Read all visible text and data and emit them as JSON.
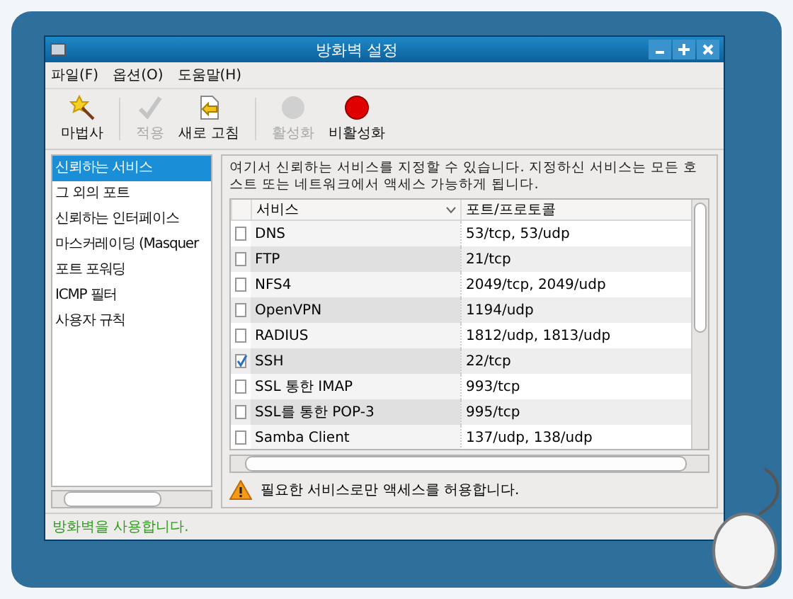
{
  "window": {
    "title": "방화벽 설정"
  },
  "menu": [
    {
      "label": "파일(F)"
    },
    {
      "label": "옵션(O)"
    },
    {
      "label": "도움말(H)"
    }
  ],
  "toolbar": [
    {
      "label": "마법사",
      "kind": "wizard",
      "disabled": false
    },
    {
      "label": "적용",
      "kind": "apply",
      "disabled": true
    },
    {
      "label": "새로 고침",
      "kind": "reload",
      "disabled": false
    },
    {
      "label": "활성화",
      "kind": "enable",
      "disabled": true
    },
    {
      "label": "비활성화",
      "kind": "disable",
      "disabled": false
    }
  ],
  "sidebar": {
    "items": [
      {
        "label": "신뢰하는 서비스",
        "selected": true
      },
      {
        "label": "그 외의 포트",
        "selected": false
      },
      {
        "label": "신뢰하는 인터페이스",
        "selected": false
      },
      {
        "label": "마스커레이딩 (Masquer",
        "selected": false
      },
      {
        "label": "포트 포워딩",
        "selected": false
      },
      {
        "label": "ICMP 필터",
        "selected": false
      },
      {
        "label": "사용자 규칙",
        "selected": false
      }
    ]
  },
  "description": "여기서 신뢰하는 서비스를 지정할 수 있습니다. 지정하신 서비스는 모든 호스트 또는 네트워크에서 액세스 가능하게 됩니다.",
  "table": {
    "columns": [
      {
        "label": "서비스",
        "sorted": true
      },
      {
        "label": "포트/프로토콜",
        "sorted": false
      }
    ],
    "rows": [
      {
        "service": "DNS",
        "ports": "53/tcp, 53/udp",
        "checked": false
      },
      {
        "service": "FTP",
        "ports": "21/tcp",
        "checked": false
      },
      {
        "service": "NFS4",
        "ports": "2049/tcp, 2049/udp",
        "checked": false
      },
      {
        "service": "OpenVPN",
        "ports": "1194/udp",
        "checked": false
      },
      {
        "service": "RADIUS",
        "ports": "1812/udp, 1813/udp",
        "checked": false
      },
      {
        "service": "SSH",
        "ports": "22/tcp",
        "checked": true
      },
      {
        "service": "SSL 통한 IMAP",
        "ports": "993/tcp",
        "checked": false
      },
      {
        "service": "SSL를 통한 POP-3",
        "ports": "995/tcp",
        "checked": false
      },
      {
        "service": "Samba Client",
        "ports": "137/udp, 138/udp",
        "checked": false
      }
    ]
  },
  "warning": "필요한 서비스로만 액세스를 허용합니다.",
  "status_bar": "방화벽을 사용합니다."
}
